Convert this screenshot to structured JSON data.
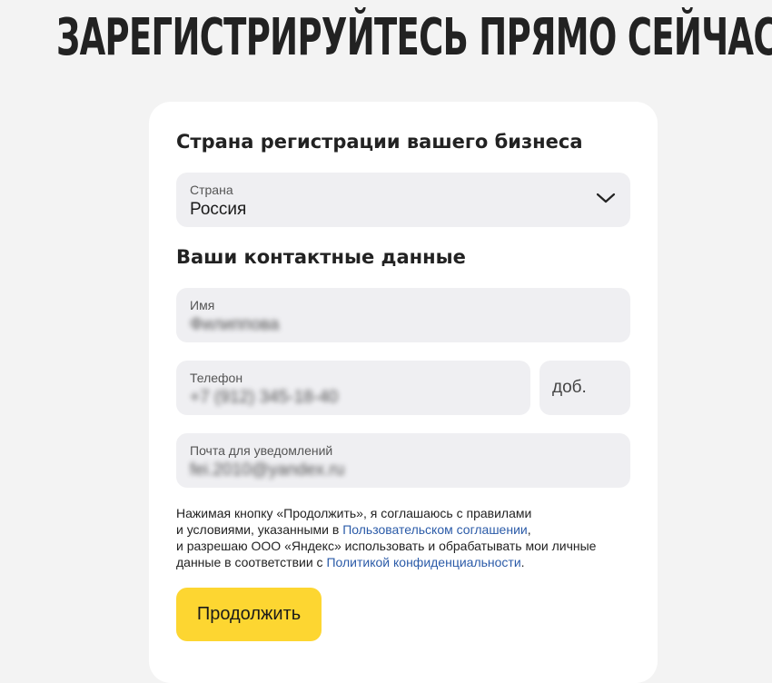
{
  "page": {
    "headline": "ЗАРЕГИСТРИРУЙТЕСЬ ПРЯМО СЕЙЧАС"
  },
  "form": {
    "country_section_title": "Страна регистрации вашего бизнеса",
    "country": {
      "label": "Страна",
      "value": "Россия",
      "icon": "chevron-down-icon"
    },
    "contact_section_title": "Ваши контактные данные",
    "name": {
      "label": "Имя",
      "value": "Филиппова",
      "obscured": true
    },
    "phone": {
      "label": "Телефон",
      "value": "+7 (912) 345-18-40",
      "obscured": true
    },
    "extension": {
      "placeholder": "доб."
    },
    "email": {
      "label": "Почта для уведомлений",
      "value": "fei.2010@yandex.ru",
      "obscured": true
    },
    "consent": {
      "line1": "Нажимая кнопку «Продолжить», я соглашаюсь с правилами",
      "line2_before": "и условиями, указанными в ",
      "user_agreement_link": "Пользовательском соглашении",
      "line2_after": ",",
      "line3": "и разрешаю ООО «Яндекс» использовать и обрабатывать мои личные",
      "line4_before": "данные в соответствии с ",
      "privacy_policy_link": "Политикой конфиденциальности",
      "line4_after": "."
    },
    "continue_label": "Продолжить"
  },
  "colors": {
    "page_background": "#f3f3f3",
    "card_background": "#ffffff",
    "field_background": "#efeff2",
    "link": "#2b5ba8",
    "button_primary": "#fdd631"
  }
}
